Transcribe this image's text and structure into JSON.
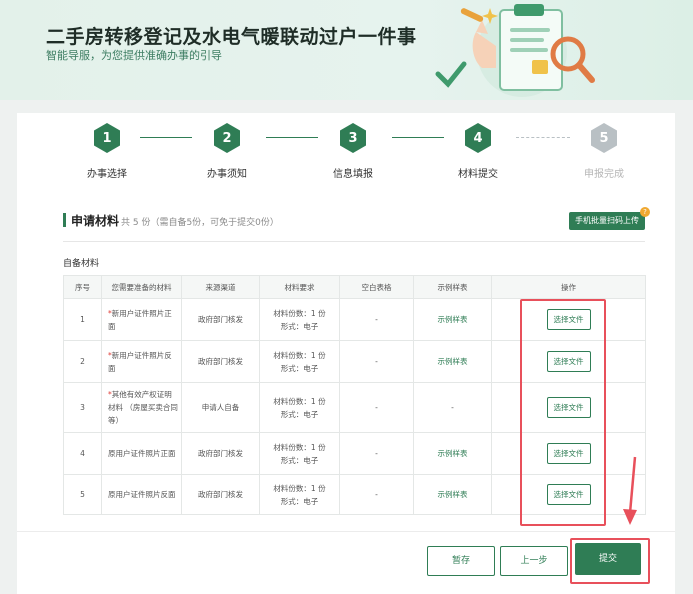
{
  "banner": {
    "title": "二手房转移登记及水电气暖联动过户一件事",
    "subtitle": "智能导服，为您提供准确办事的引导"
  },
  "steps": [
    {
      "num": "1",
      "label": "办事选择",
      "active": true
    },
    {
      "num": "2",
      "label": "办事须知",
      "active": true
    },
    {
      "num": "3",
      "label": "信息填报",
      "active": true
    },
    {
      "num": "4",
      "label": "材料提交",
      "active": true
    },
    {
      "num": "5",
      "label": "申报完成",
      "active": false
    }
  ],
  "section": {
    "title": "申请材料",
    "count": "共 5 份（需自备5份，可免于提交0份）",
    "scan_button": "手机批量扫码上传",
    "scan_badge": "?",
    "group_label": "自备材料"
  },
  "table": {
    "headers": [
      "序号",
      "您需要准备的材料",
      "来源渠道",
      "材料要求",
      "空白表格",
      "示例样表",
      "操作"
    ],
    "rows": [
      {
        "no": "1",
        "star": "*",
        "name": "新用户证件照片正面",
        "source": "政府部门核发",
        "req1": "材料份数：1 份",
        "req2": "形式：电子",
        "blank": "-",
        "sample": "示例样表",
        "action": "选择文件"
      },
      {
        "no": "2",
        "star": "*",
        "name": "新用户证件照片反面",
        "source": "政府部门核发",
        "req1": "材料份数：1 份",
        "req2": "形式：电子",
        "blank": "-",
        "sample": "示例样表",
        "action": "选择文件"
      },
      {
        "no": "3",
        "star": "*",
        "name": "其他有效产权证明材料 （房屋买卖合同等）",
        "source": "申请人自备",
        "req1": "材料份数：1 份",
        "req2": "形式：电子",
        "blank": "-",
        "sample": "-",
        "action": "选择文件"
      },
      {
        "no": "4",
        "star": "",
        "name": "原用户证件照片正面",
        "source": "政府部门核发",
        "req1": "材料份数：1 份",
        "req2": "形式：电子",
        "blank": "-",
        "sample": "示例样表",
        "action": "选择文件"
      },
      {
        "no": "5",
        "star": "",
        "name": "原用户证件照片反面",
        "source": "政府部门核发",
        "req1": "材料份数：1 份",
        "req2": "形式：电子",
        "blank": "-",
        "sample": "示例样表",
        "action": "选择文件"
      }
    ]
  },
  "footer": {
    "save": "暂存",
    "prev": "上一步",
    "submit": "提交"
  },
  "colors": {
    "brand": "#2f7d55",
    "highlight": "#e8505b",
    "inactive": "#b9c0c4"
  },
  "icons": [
    "banner-illustration",
    "arrow-down-icon",
    "question-badge-icon"
  ]
}
